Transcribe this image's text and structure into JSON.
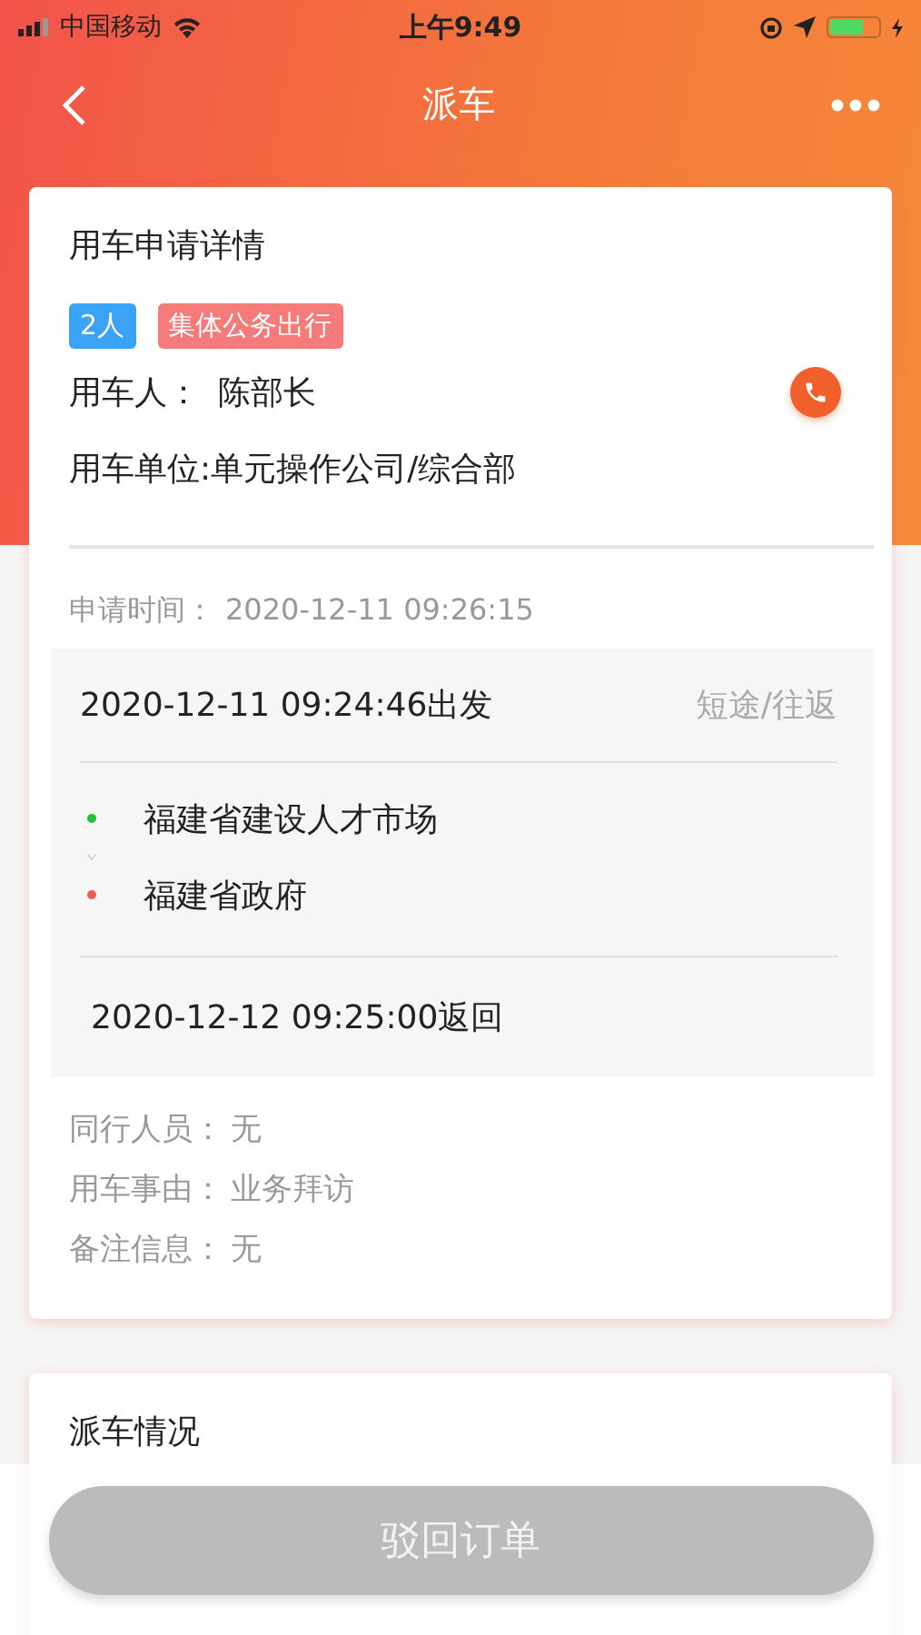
{
  "status_bar": {
    "carrier": "中国移动",
    "time": "上午9:49"
  },
  "nav": {
    "title": "派车"
  },
  "request_card": {
    "title": "用车申请详情",
    "tags": [
      {
        "label": "2人",
        "color": "#3aa3f5"
      },
      {
        "label": "集体公务出行",
        "color": "#f57b7b"
      }
    ],
    "user_label": "用车人：",
    "user_name": "陈部长",
    "unit": "用车单位:单元操作公司/综合部",
    "apply_label": "申请时间：",
    "apply_time": "2020-12-11 09:26:15",
    "trip": {
      "departure": "2020-12-11 09:24:46出发",
      "type": "短途/往返",
      "stops": [
        {
          "name": "福建省建设人才市场",
          "color": "#22c33a"
        },
        {
          "name": "福建省政府",
          "color": "#f05a5a"
        }
      ],
      "return": "2020-12-12 09:25:00返回"
    },
    "details": [
      {
        "label": "同行人员：",
        "value": "无"
      },
      {
        "label": "用车事由：",
        "value": "业务拜访"
      },
      {
        "label": "备注信息：",
        "value": "无"
      }
    ]
  },
  "dispatch_card": {
    "title": "派车情况"
  },
  "reject_button": {
    "label": "驳回订单",
    "disabled": true
  }
}
